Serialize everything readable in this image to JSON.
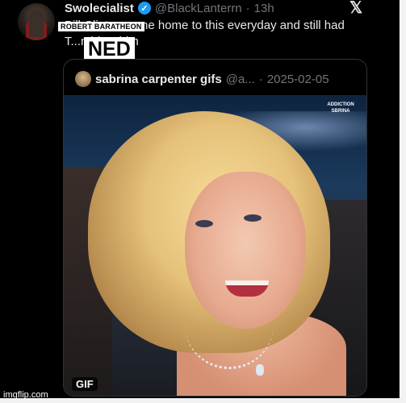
{
  "tweet": {
    "display_name": "Swolecialist",
    "verified_glyph": "✓",
    "handle": "@BlackLanterrn",
    "separator": "·",
    "time": "13h",
    "text": "Bill Clinton came home to this everyday and still had T...n blow him"
  },
  "header": {
    "x_logo": "𝕏"
  },
  "overlay_labels": {
    "robert": "ROBERT BARATHEON",
    "ned": "NED"
  },
  "quote": {
    "display_name": "sabrina carpenter gifs",
    "handle": "@a...",
    "separator": "·",
    "date": "2025-02-05",
    "watermark": "ADDICTION SBRINA",
    "media_badge": "GIF"
  },
  "footer": {
    "watermark": "imgflip.com"
  },
  "colors": {
    "background": "#000000",
    "text": "#e7e9ea",
    "muted": "#71767b",
    "verified": "#1d9bf0",
    "border": "#2f3336"
  },
  "icons": [
    "verified-badge-icon",
    "x-logo-icon"
  ]
}
